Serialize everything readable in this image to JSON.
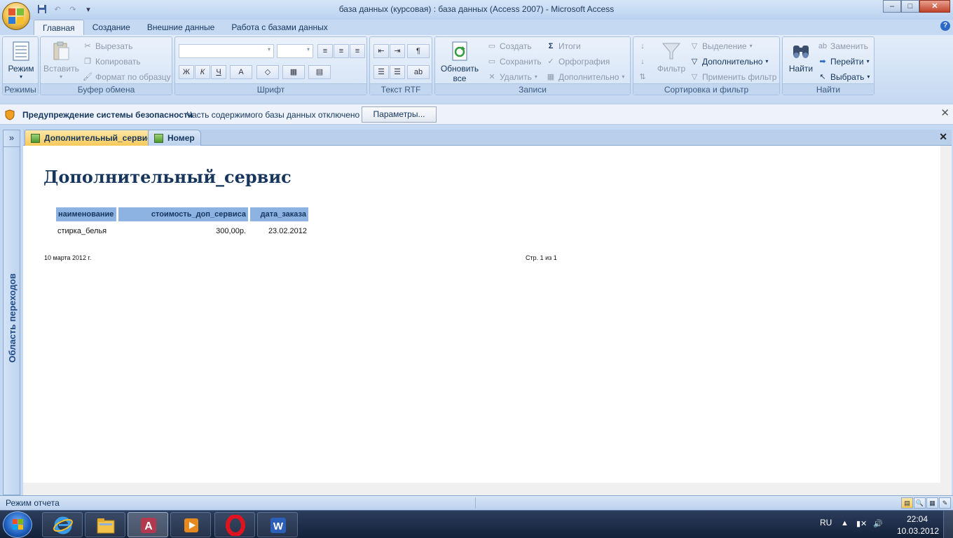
{
  "window": {
    "title": "база данных (курсовая) : база данных (Access 2007)  -  Microsoft Access",
    "controls": [
      "–",
      "□",
      "✕"
    ]
  },
  "quick_access": [
    "save-icon",
    "undo-icon",
    "redo-icon",
    "customize-icon"
  ],
  "ribbon_tabs": [
    "Главная",
    "Создание",
    "Внешние данные",
    "Работа с базами данных"
  ],
  "ribbon": {
    "modes": {
      "label": "Режимы",
      "button": "Режим"
    },
    "clipboard": {
      "label": "Буфер обмена",
      "paste": "Вставить",
      "cut": "Вырезать",
      "copy": "Копировать",
      "format_painter": "Формат по образцу"
    },
    "font": {
      "label": "Шрифт",
      "bold": "Ж",
      "italic": "К",
      "underline": "Ч",
      "font_color": "A"
    },
    "rtf": {
      "label": "Текст RTF"
    },
    "records": {
      "label": "Записи",
      "refresh_line1": "Обновить",
      "refresh_line2": "все",
      "create": "Создать",
      "save": "Сохранить",
      "delete": "Удалить",
      "totals": "Итоги",
      "spelling": "Орфография",
      "more": "Дополнительно"
    },
    "sort_filter": {
      "label": "Сортировка и фильтр",
      "filter": "Фильтр",
      "selection": "Выделение",
      "advanced": "Дополнительно",
      "apply_filter": "Применить фильтр"
    },
    "find": {
      "label": "Найти",
      "find": "Найти",
      "replace": "Заменить",
      "goto": "Перейти",
      "select": "Выбрать"
    }
  },
  "security_bar": {
    "title": "Предупреждение системы безопасности",
    "message": "Часть содержимого базы данных отключено",
    "button": "Параметры..."
  },
  "nav_pane": {
    "label": "Область переходов",
    "toggle": "»"
  },
  "doc_tabs": [
    {
      "label": "Дополнительный_сервис",
      "active": true
    },
    {
      "label": "Номер",
      "active": false
    }
  ],
  "report": {
    "title": "Дополнительный_сервис",
    "columns": [
      "наименование",
      "стоимость_доп_сервиса",
      "дата_заказа"
    ],
    "rows": [
      [
        "стирка_белья",
        "300,00р.",
        "23.02.2012"
      ]
    ],
    "footer_date": "10 марта 2012 г.",
    "footer_page": "Стр. 1 из 1"
  },
  "status": {
    "mode": "Режим отчета"
  },
  "taskbar": {
    "apps": [
      "internet-explorer-icon",
      "explorer-folder-icon",
      "access-icon",
      "media-player-icon",
      "opera-icon",
      "word-icon"
    ],
    "lang": "RU",
    "time": "22:04",
    "date": "10.03.2012"
  },
  "colors": {
    "accent": "#8db3e2",
    "active_tab": "#f7c95a",
    "title_text": "#17365d"
  }
}
